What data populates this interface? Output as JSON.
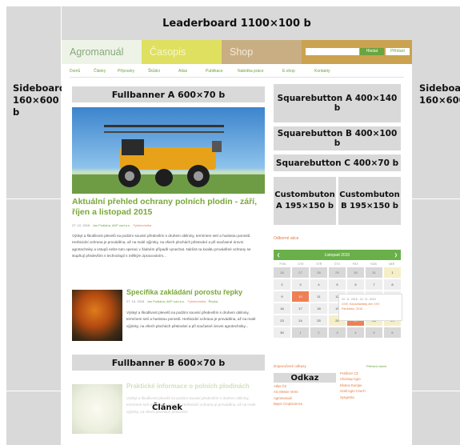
{
  "ad_slots": {
    "leaderboard": "Leaderboard  1100×100 b",
    "sideboard_left": [
      "Sideboard",
      "160×600 b"
    ],
    "sideboard_right": [
      "Sideboard",
      "160×600 b"
    ],
    "fullbanner_a": "Fullbanner A  600×70 b",
    "fullbanner_b": "Fullbanner B  600×70 b",
    "squarebutton_a": "Squarebutton A  400×140 b",
    "squarebutton_b": "Squarebutton B  400×100 b",
    "squarebutton_c": "Squarebutton C  400×70 b",
    "custombutton_a": [
      "Custombuton",
      "A  195×150 b"
    ],
    "custombutton_b": [
      "Custombuton",
      "B  195×150 b"
    ],
    "odkaz": "Odkaz",
    "clanek": "Článek"
  },
  "topbar": {
    "tabs": [
      "Agromanuál",
      "Časopis",
      "Shop"
    ],
    "search_button": "Hledat",
    "login": "Přihlásit"
  },
  "nav": [
    "Domů",
    "Články",
    "Přípravky",
    "Škůdci",
    "Atlas",
    "Publikace",
    "Nabídka práce",
    "E-shop",
    "Kontakty"
  ],
  "article1": {
    "title": "Aktuální přehled ochrany polních plodin - září, říjen a listopad 2015",
    "meta_date": "27. 10. 2015",
    "meta_author": "Jan Podlaha, AKP nad a.s.",
    "meta_tag": "Fytotechnika",
    "text": "Výskyt a škodlivost plevelů na podzim souvisí především s druhem obilniny, termínem setí a hustotou porostů. Herbicidní ochrana je prováděna, až na malé výjimky, na všech plochách pěstování a při současné úrovni agrotechniky a vstupů nelze tuto operaci v žádném případě vynechat. Nárůst na kvalitu prováděné ochrany se stupňují především s technologií s mělkým zpracováním..."
  },
  "article2": {
    "title": "Specifika zakládání porostu řepky",
    "meta_date": "27. 10. 2015",
    "meta_author": "Jan Podlaha, AKP nad a.s.",
    "meta_tag": "Fytotechnika",
    "meta_extra": "Řepka",
    "text": "Výskyt a škodlivost plevelů na podzim souvisí především s druhem obilniny, termínem setí a hustotou porostů. Herbicidní ochrana je prováděna, až na malé výjimky, na všech plochách pěstování a při současné úrovni agrotechniky..."
  },
  "article3": {
    "title": "Praktické informace o polních plodinách",
    "text": "Výskyt a škodlivost plevelů na podzim souvisí především s druhem obilniny, termínem setí a hustotou porostů. Herbicidní ochrana je prováděna, až na malé výjimky, na všech plochách pěstování."
  },
  "sidebar": {
    "odborne_akce": "Odborné akce",
    "calendar_title": "Listopad 2015",
    "calendar_days": [
      "PON",
      "ÚTE",
      "STŘ",
      "ČTV",
      "PÁT",
      "SOB",
      "NEĚ"
    ],
    "calendar_cells": [
      "26",
      "27",
      "28",
      "29",
      "30",
      "31",
      "1",
      "2",
      "3",
      "4",
      "5",
      "6",
      "7",
      "8",
      "9",
      "10",
      "11",
      "12",
      "13",
      "14",
      "15",
      "16",
      "17",
      "18",
      "19",
      "20",
      "21",
      "22",
      "23",
      "24",
      "25",
      "26",
      "27",
      "28",
      "29",
      "30",
      "1",
      "2",
      "3",
      "4",
      "5",
      "6"
    ],
    "popup_lines": [
      "20. 11. 2015 - 22. 11. 2015",
      "XXIV. Konzultantský den XXV",
      "Pardubice, 2015"
    ],
    "doporucene": "Doporučené odkazy",
    "prehled": "Přehled všech",
    "links_left": [
      "Atlas ČZ",
      "AG Messe Verre",
      "Agromanuál",
      "Bayer CropScience"
    ],
    "links_right": [
      "Fertilizer CZ",
      "Chemap Agro",
      "Ekotox Europe",
      "Gold Agro Czech",
      "Syngenta"
    ]
  },
  "colors": {
    "placeholder_gray": "#d9d9d9",
    "brand_green": "#6aa43e",
    "link_orange": "#e07a40"
  }
}
